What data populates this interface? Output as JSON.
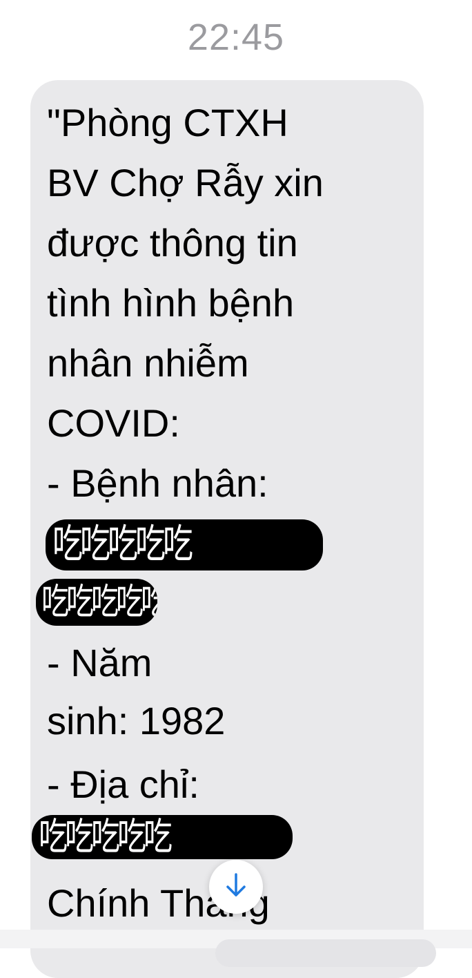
{
  "header": {
    "timestamp": "22:45"
  },
  "message": {
    "lines": [
      "\"Phòng CTXH",
      "BV Chợ Rẫy xin",
      "được thông tin",
      "tình hình bệnh",
      "nhân nhiễm",
      "COVID:",
      "- Bệnh nhân:",
      "- Năm",
      "sinh: 1982",
      "- Địa chỉ:",
      "Chính Thắng"
    ],
    "redaction_glyphs": "吃吃吃吃吃"
  },
  "colors": {
    "bubble": "#e9e9eb",
    "timestamp": "#9b9b9f",
    "scroll_arrow": "#1f7ae0"
  },
  "icons": {
    "scroll_down": "arrow-down-icon"
  }
}
